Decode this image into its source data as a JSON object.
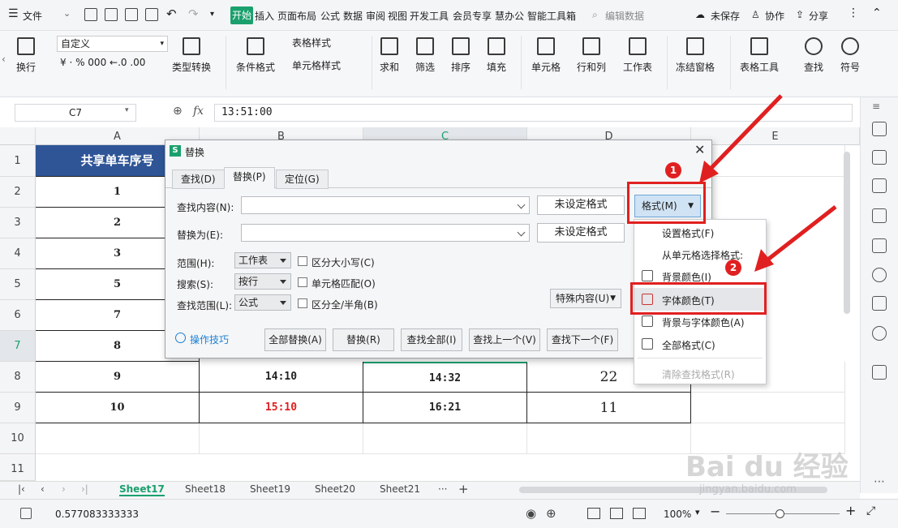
{
  "menubar": {
    "file": "文件",
    "tabs": [
      "开始",
      "插入",
      "页面布局",
      "公式",
      "数据",
      "审阅",
      "视图",
      "开发工具",
      "会员专享",
      "慧办公",
      "智能工具箱"
    ],
    "search": "编辑数据",
    "unsaved": "未保存",
    "collab": "协作",
    "share": "分享"
  },
  "ribbon": {
    "wrap": "换行",
    "format_value": "自定义",
    "num_symbols": "¥ · % 000 ←.0 .00",
    "type_convert": "类型转换",
    "cond_format": "条件格式",
    "table_style": "表格样式",
    "cell_style": "单元格样式",
    "sum": "求和",
    "filter": "筛选",
    "sort": "排序",
    "fill": "填充",
    "cell": "单元格",
    "rowcol": "行和列",
    "sheet": "工作表",
    "freeze": "冻结窗格",
    "table_tools": "表格工具",
    "find": "查找",
    "symbol": "符号"
  },
  "formula": {
    "namebox": "C7",
    "fx": "fx",
    "value": "13:51:00"
  },
  "grid": {
    "columns": [
      "A",
      "B",
      "C",
      "D",
      "E"
    ],
    "rows": [
      "1",
      "2",
      "3",
      "4",
      "5",
      "6",
      "7",
      "8",
      "9",
      "10",
      "11"
    ],
    "header_a1": "共享单车序号",
    "col_a": [
      "1",
      "2",
      "3",
      "5",
      "7",
      "8",
      "9",
      "10"
    ],
    "row8": {
      "b": "14:10",
      "c": "14:32",
      "d": "22"
    },
    "row9": {
      "b": "15:10",
      "c": "16:21",
      "d": "11"
    },
    "colors": {
      "header_bg": "#2f5597",
      "red_text": "#e02020",
      "accent": "#1aa06d"
    }
  },
  "dialog": {
    "title": "替换",
    "tabs": [
      "查找(D)",
      "替换(P)",
      "定位(G)"
    ],
    "find_label": "查找内容(N):",
    "replace_label": "替换为(E):",
    "no_format": "未设定格式",
    "format_btn": "格式(M)",
    "scope_label": "范围(H):",
    "scope_value": "工作表",
    "search_label": "搜索(S):",
    "search_value": "按行",
    "lookin_label": "查找范围(L):",
    "lookin_value": "公式",
    "opt_case": "区分大小写(C)",
    "opt_cell": "单元格匹配(O)",
    "opt_width": "区分全/半角(B)",
    "special": "特殊内容(U)",
    "tips": "操作技巧",
    "btn_replace_all": "全部替换(A)",
    "btn_replace": "替换(R)",
    "btn_find_all": "查找全部(I)",
    "btn_prev": "查找上一个(V)",
    "btn_next": "查找下一个(F)"
  },
  "menu": {
    "set_format": "设置格式(F)",
    "from_cell": "从单元格选择格式:",
    "bg_color": "背景颜色(I)",
    "font_color": "字体颜色(T)",
    "bg_font_color": "背景与字体颜色(A)",
    "all_format": "全部格式(C)",
    "clear_format": "清除查找格式(R)"
  },
  "badges": {
    "one": "1",
    "two": "2"
  },
  "sheets": {
    "tabs": [
      "Sheet17",
      "Sheet18",
      "Sheet19",
      "Sheet20",
      "Sheet21"
    ],
    "more": "···",
    "add": "+"
  },
  "status": {
    "value": "0.577083333333",
    "zoom": "100%"
  },
  "watermark": {
    "line1": "Bai du 经验",
    "line2": "jingyan.baidu.com"
  }
}
